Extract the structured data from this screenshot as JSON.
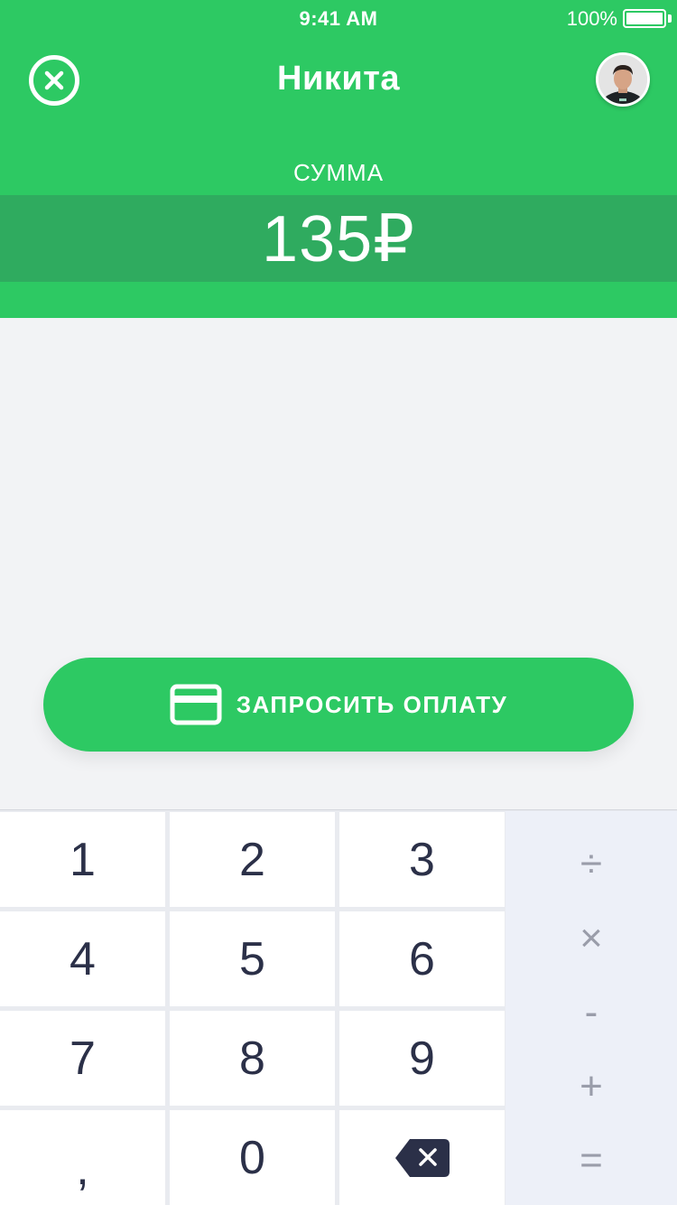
{
  "status_bar": {
    "time": "9:41 AM",
    "battery": "100%"
  },
  "header": {
    "title": "Никита",
    "sum_label": "СУММА",
    "amount": "135₽",
    "close_icon": "close-circle-icon",
    "avatar_icon": "user-avatar"
  },
  "request": {
    "label": "ЗАПРОСИТЬ ОПЛАТУ",
    "icon": "credit-card-icon"
  },
  "keypad": {
    "keys": [
      "1",
      "2",
      "3",
      "4",
      "5",
      "6",
      "7",
      "8",
      "9",
      ",",
      "0"
    ],
    "backspace_icon": "backspace-icon",
    "operators": [
      "÷",
      "×",
      "-",
      "+",
      "="
    ]
  },
  "colors": {
    "accent": "#2dc963",
    "accent_dark": "#2fab5f",
    "keypad_text": "#2b3048",
    "operator_text": "#9a9daa",
    "background": "#f2f3f5"
  }
}
